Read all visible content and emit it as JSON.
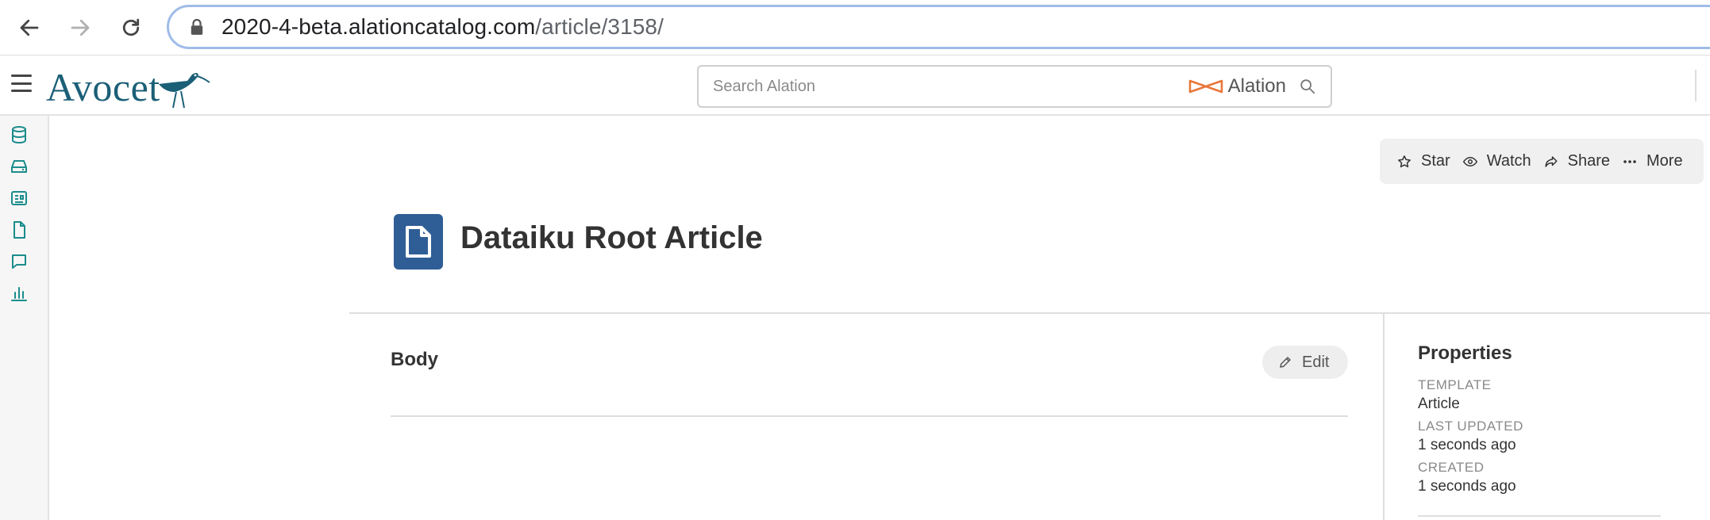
{
  "browser": {
    "url_host": "2020-4-beta.alationcatalog.com",
    "url_path": "/article/3158/"
  },
  "header": {
    "logo_text": "Avocet",
    "search_placeholder": "Search Alation",
    "brand_word": "Alation"
  },
  "actions": [
    {
      "label": "Star",
      "icon": "star-icon"
    },
    {
      "label": "Watch",
      "icon": "eye-icon"
    },
    {
      "label": "Share",
      "icon": "share-icon"
    },
    {
      "label": "More",
      "icon": "ellipsis-icon"
    }
  ],
  "page": {
    "title": "Dataiku Root Article",
    "body_label": "Body",
    "edit_label": "Edit"
  },
  "properties": {
    "title": "Properties",
    "items": [
      {
        "key": "TEMPLATE",
        "value": "Article"
      },
      {
        "key": "LAST UPDATED",
        "value": "1 seconds ago"
      },
      {
        "key": "CREATED",
        "value": "1 seconds ago"
      }
    ]
  },
  "colors": {
    "accent": "#2f5e96",
    "teal": "#1b8c8c",
    "logo": "#1b5f77",
    "alation_orange": "#e8773a"
  }
}
